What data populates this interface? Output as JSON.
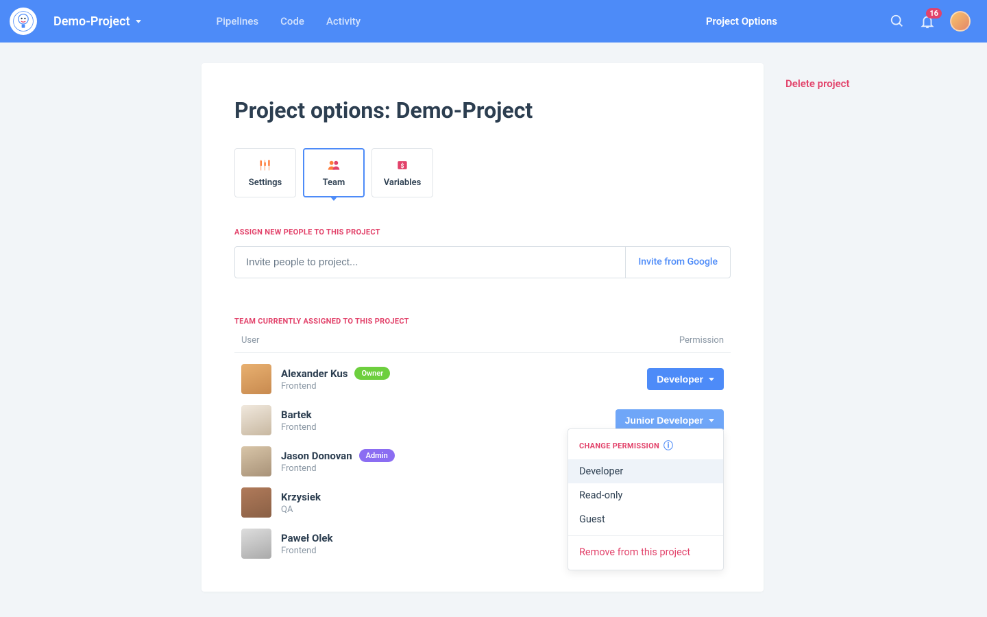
{
  "header": {
    "project_name": "Demo-Project",
    "nav": {
      "pipelines": "Pipelines",
      "code": "Code",
      "activity": "Activity"
    },
    "project_options": "Project Options",
    "notif_count": "16"
  },
  "page": {
    "title": "Project options: Demo-Project",
    "tabs": {
      "settings": "Settings",
      "team": "Team",
      "variables": "Variables"
    },
    "assign_label": "ASSIGN NEW PEOPLE TO THIS PROJECT",
    "invite_placeholder": "Invite people to project...",
    "invite_google": "Invite from Google",
    "team_label": "TEAM CURRENTLY ASSIGNED TO THIS PROJECT",
    "col_user": "User",
    "col_permission": "Permission"
  },
  "members": [
    {
      "name": "Alexander Kus",
      "role": "Frontend",
      "badge": "Owner",
      "badge_class": "owner",
      "perm": "Developer",
      "perm_class": "darker"
    },
    {
      "name": "Bartek",
      "role": "Frontend",
      "badge": "",
      "perm": "Junior Developer",
      "perm_class": "",
      "dropdown": true
    },
    {
      "name": "Jason Donovan",
      "role": "Frontend",
      "badge": "Admin",
      "badge_class": "admin",
      "perm": ""
    },
    {
      "name": "Krzysiek",
      "role": "QA",
      "badge": "",
      "perm": ""
    },
    {
      "name": "Paweł Olek",
      "role": "Frontend",
      "badge": "",
      "perm": ""
    }
  ],
  "dropdown": {
    "header": "CHANGE PERMISSION",
    "opts": [
      "Developer",
      "Read-only",
      "Guest"
    ],
    "remove": "Remove from this project"
  },
  "side": {
    "delete": "Delete project"
  }
}
